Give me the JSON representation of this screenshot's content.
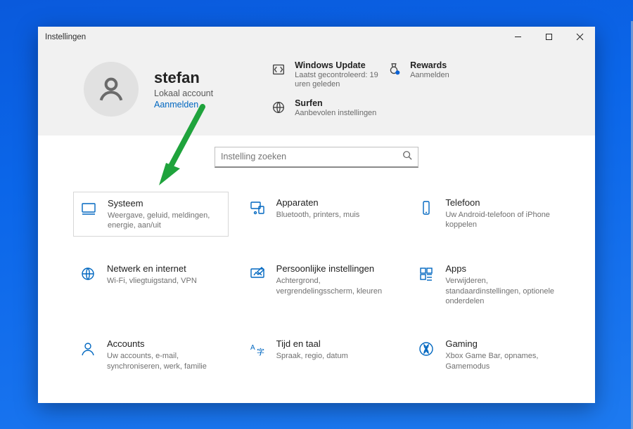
{
  "window": {
    "title": "Instellingen"
  },
  "user": {
    "name": "stefan",
    "account_type": "Lokaal account",
    "sign_in": "Aanmelden"
  },
  "header_tiles": {
    "update": {
      "title": "Windows Update",
      "sub": "Laatst gecontroleerd: 19 uren geleden"
    },
    "rewards": {
      "title": "Rewards",
      "sub": "Aanmelden"
    },
    "surf": {
      "title": "Surfen",
      "sub": "Aanbevolen instellingen"
    }
  },
  "search": {
    "placeholder": "Instelling zoeken"
  },
  "categories": [
    {
      "key": "systeem",
      "title": "Systeem",
      "desc": "Weergave, geluid, meldingen, energie, aan/uit"
    },
    {
      "key": "apparaten",
      "title": "Apparaten",
      "desc": "Bluetooth, printers, muis"
    },
    {
      "key": "telefoon",
      "title": "Telefoon",
      "desc": "Uw Android-telefoon of iPhone koppelen"
    },
    {
      "key": "netwerk",
      "title": "Netwerk en internet",
      "desc": "Wi-Fi, vliegtuigstand, VPN"
    },
    {
      "key": "personal",
      "title": "Persoonlijke instellingen",
      "desc": "Achtergrond, vergrendelingsscherm, kleuren"
    },
    {
      "key": "apps",
      "title": "Apps",
      "desc": "Verwijderen, standaardinstellingen, optionele onderdelen"
    },
    {
      "key": "accounts",
      "title": "Accounts",
      "desc": "Uw accounts, e-mail, synchroniseren, werk, familie"
    },
    {
      "key": "time",
      "title": "Tijd en taal",
      "desc": "Spraak, regio, datum"
    },
    {
      "key": "gaming",
      "title": "Gaming",
      "desc": "Xbox Game Bar, opnames, Gamemodus"
    }
  ]
}
